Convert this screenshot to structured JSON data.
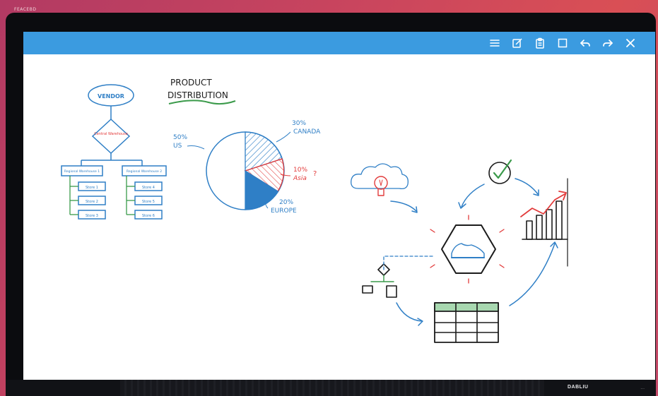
{
  "device": {
    "brand_corner": "FEACEBD",
    "bezel_logo": "DABLIU",
    "bezel_left_text": "",
    "bezel_right_text": "..."
  },
  "toolbar": {
    "tools": [
      {
        "name": "menu-icon",
        "label": "Menu"
      },
      {
        "name": "note-icon",
        "label": "Note"
      },
      {
        "name": "clipboard-icon",
        "label": "Paste"
      },
      {
        "name": "square-icon",
        "label": "Select"
      },
      {
        "name": "undo-icon",
        "label": "Undo"
      },
      {
        "name": "redo-icon",
        "label": "Redo"
      },
      {
        "name": "close-icon",
        "label": "Close"
      }
    ],
    "color": "#3b9be0"
  },
  "whiteboard": {
    "flowchart": {
      "top": "VENDOR",
      "decision": "Central Warehouse",
      "regional_left": "Regional Warehouse 1",
      "regional_right": "Regional Warehouse 2",
      "stores_left": [
        "Store 1",
        "Store 2",
        "Store 3"
      ],
      "stores_right": [
        "Store 4",
        "Store 5",
        "Store 6"
      ]
    },
    "pie_title_line1": "PRODUCT",
    "pie_title_line2": "DISTRIBUTION",
    "pie_labels": {
      "us_pct": "50%",
      "us_name": "US",
      "canada_pct": "30%",
      "canada_name": "CANADA",
      "asia_pct": "10%",
      "asia_name": "Asia",
      "asia_mark": "?",
      "europe_pct": "20%",
      "europe_name": "EUROPE"
    }
  },
  "colors": {
    "ink_blue": "#2f7fc6",
    "ink_red": "#e23b3b",
    "ink_green": "#3a9a4a",
    "ink_black": "#1b1b1b"
  }
}
